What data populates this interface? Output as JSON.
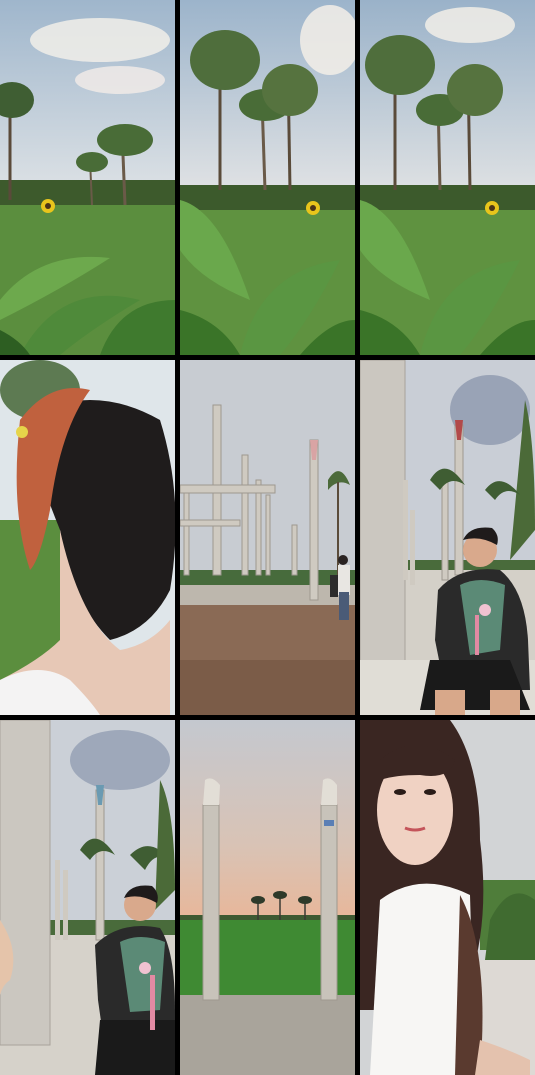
{
  "collage": {
    "rows": 3,
    "columns": 3,
    "frames": [
      {
        "scene": "banana-field-sunflower"
      },
      {
        "scene": "banana-field-sunflower"
      },
      {
        "scene": "banana-field-sunflower"
      },
      {
        "scene": "woman-hair-closeup"
      },
      {
        "scene": "construction-pillars"
      },
      {
        "scene": "woman-sitting-by-pillar"
      },
      {
        "scene": "woman-sitting-by-pillar"
      },
      {
        "scene": "pillars-rice-field-dusk"
      },
      {
        "scene": "woman-selfie"
      }
    ]
  },
  "palette": {
    "sky": "#b9c7d8",
    "grass": "#4e8a3c",
    "leaf": "#5e9a48",
    "concrete": "#c9c5bd",
    "dusk": "#e9b99a"
  }
}
